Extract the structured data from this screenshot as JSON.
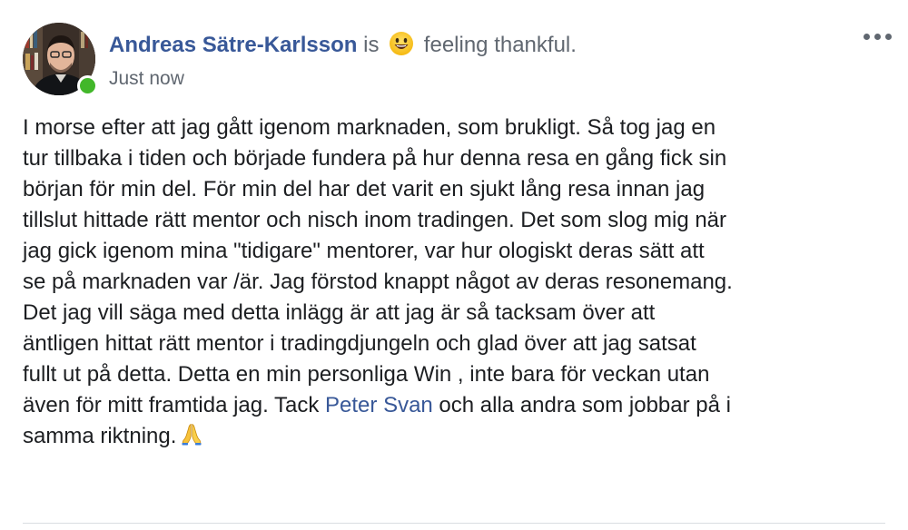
{
  "post": {
    "author": "Andreas Sätre-Karlsson",
    "activity_prefix": "is",
    "activity": "feeling thankful.",
    "feeling_emoji": "smiling-face-icon",
    "timestamp": "Just now",
    "body_lines": [
      "I morse efter att jag gått igenom marknaden, som brukligt. Så tog jag en",
      "tur tillbaka i tiden och började fundera på hur denna resa en gång fick sin",
      "början för min del. För min del har det varit en sjukt lång resa innan jag",
      "tillslut hittade rätt mentor och nisch inom tradingen. Det som slog mig när",
      "jag gick igenom mina \"tidigare\" mentorer, var hur ologiskt deras sätt att",
      "se på marknaden var /är. Jag förstod knappt något av deras resonemang.",
      "Det jag vill säga med detta inlägg är att jag är så tacksam över att",
      "äntligen hittat rätt mentor i tradingdjungeln och glad över att jag satsat",
      "fullt ut på detta. Detta en min personliga Win , inte bara för veckan utan"
    ],
    "line_10_before": "även för mitt framtida jag. Tack ",
    "mention": "Peter Svan",
    "line_10_after": " och alla andra som jobbar på i",
    "line_11": "samma riktning.",
    "end_emoji": "folded-hands-icon"
  },
  "colors": {
    "link": "#385898",
    "meta": "#606770",
    "text": "#1c1e21",
    "online": "#42b72a"
  }
}
